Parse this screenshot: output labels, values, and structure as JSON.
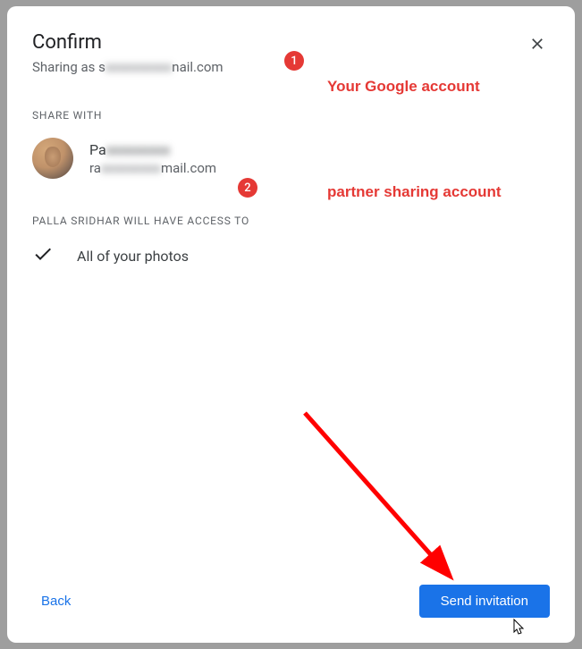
{
  "header": {
    "title": "Confirm",
    "subtitle_prefix": "Sharing as s",
    "subtitle_blurred": "xxxxxxxxxx",
    "subtitle_suffix": "nail.com"
  },
  "share_with_label": "SHARE WITH",
  "person": {
    "name_prefix": "Pa",
    "name_blurred": "xxxxxxxxx",
    "email_prefix": "ra",
    "email_blurred": "xxxxxxxxx",
    "email_suffix": "mail.com"
  },
  "access_label": "PALLA SRIDHAR WILL HAVE ACCESS TO",
  "access_item": "All of your photos",
  "footer": {
    "back": "Back",
    "send": "Send invitation"
  },
  "annotations": {
    "badge1": "1",
    "badge2": "2",
    "text1": "Your Google account",
    "text2": "partner sharing account"
  }
}
